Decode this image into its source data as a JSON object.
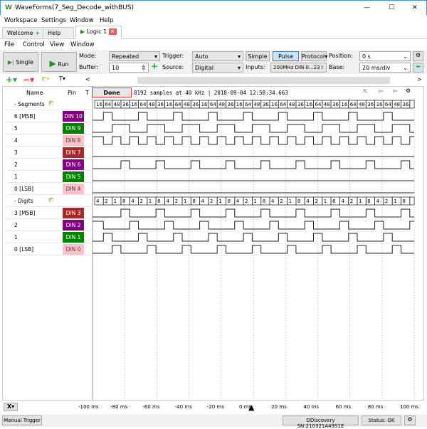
{
  "window": {
    "title": "WaveForms",
    "subtitle": "(7_Seg_Decode_withBUS)",
    "minimize": "—",
    "maximize": "☐",
    "close": "✕"
  },
  "menu": [
    "Workspace",
    "Settings",
    "Window",
    "Help"
  ],
  "tabs": [
    {
      "label": "Welcome"
    },
    {
      "label": "Help"
    },
    {
      "label": "Logic 1"
    }
  ],
  "submenu": [
    "File",
    "Control",
    "View",
    "Window"
  ],
  "toolbar": {
    "single": "Single",
    "run": "Run",
    "mode_label": "Mode:",
    "mode": "Repeated",
    "buffer_label": "Buffer:",
    "buffer": "10",
    "trigger_label": "Trigger:",
    "trigger": "Auto",
    "source_label": "Source:",
    "source": "Digital",
    "simple": "Simple",
    "pulse": "Pulse",
    "protocol": "Protocol",
    "inputs_label": "Inputs:",
    "inputs": "200MHz DIN 0...23 I",
    "position_label": "Position:",
    "position": "0 s",
    "base_label": "Base:",
    "base": "20 ms/div",
    "scroll_left": "<",
    "scroll_right": ">",
    "t_menu": "T"
  },
  "header": {
    "name": "Name",
    "pin": "Pin",
    "t": "T",
    "status": "Done",
    "info": "8192 samples at 40 kHz | 2018-09-04 12:58:34.663"
  },
  "groups": [
    {
      "name": "Segments",
      "bus_values": [
        "16",
        "64",
        "48",
        "36"
      ],
      "rows": [
        {
          "name": "6 [MSB]",
          "pin": "DIN 10",
          "color": "#800080",
          "bit": 6
        },
        {
          "name": "5",
          "pin": "DIN 9",
          "color": "#008000",
          "bit": 5
        },
        {
          "name": "4",
          "pin": "DIN 8",
          "color": "#ffc0cb",
          "bit": 4
        },
        {
          "name": "3",
          "pin": "DIN 7",
          "color": "#a52a2a",
          "bit": 3
        },
        {
          "name": "2",
          "pin": "DIN 6",
          "color": "#800080",
          "bit": 2
        },
        {
          "name": "1",
          "pin": "DIN 5",
          "color": "#008000",
          "bit": 1
        },
        {
          "name": "0 [LSB]",
          "pin": "DIN 4",
          "color": "#ffc0cb",
          "bit": 0
        }
      ]
    },
    {
      "name": "Digits",
      "bus_values": [
        "4",
        "2",
        "1",
        "8"
      ],
      "rows": [
        {
          "name": "3 [MSB]",
          "pin": "DIN 3",
          "color": "#a52a2a",
          "bit": 3
        },
        {
          "name": "2",
          "pin": "DIN 2",
          "color": "#800080",
          "bit": 2
        },
        {
          "name": "1",
          "pin": "DIN 1",
          "color": "#008000",
          "bit": 1
        },
        {
          "name": "0 [LSB]",
          "pin": "DIN 0",
          "color": "#ffc0cb",
          "bit": 0
        }
      ]
    }
  ],
  "axis": {
    "ticks": [
      "-100 ms",
      "-80 ms",
      "-60 ms",
      "-40 ms",
      "-20 ms",
      "0 ms",
      "20 ms",
      "40 ms",
      "60 ms",
      "80 ms",
      "100 ms"
    ],
    "x_menu": "X"
  },
  "status": {
    "manual": "Manual Trigger",
    "device": "DDiscovery SN:210321A4951E",
    "state": "Status: OK"
  }
}
